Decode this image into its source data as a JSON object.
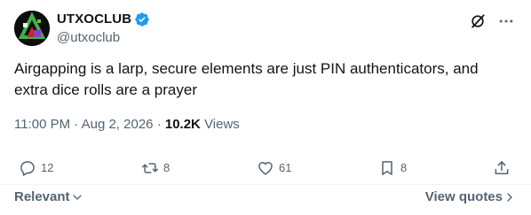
{
  "author": {
    "display_name": "UTXOCLUB",
    "handle": "@utxoclub",
    "verified": true
  },
  "tweet": {
    "text": "Airgapping is a larp, secure elements are just PIN authenticators, and extra dice rolls are a prayer",
    "time": "11:00 PM",
    "separator": "·",
    "date": "Aug 2, 2026",
    "views_count": "10.2K",
    "views_label": "Views"
  },
  "actions": {
    "replies": "12",
    "reposts": "8",
    "likes": "61",
    "bookmarks": "8"
  },
  "footer": {
    "sort_label": "Relevant",
    "view_quotes_label": "View quotes"
  },
  "colors": {
    "text": "#0f1419",
    "secondary": "#536471",
    "verified": "#1d9bf0",
    "divider": "#eff3f4"
  },
  "icons": [
    "avatar-logo",
    "verified-badge-icon",
    "grok-icon",
    "more-icon",
    "reply-icon",
    "repost-icon",
    "like-icon",
    "bookmark-icon",
    "share-icon",
    "chevron-down-icon",
    "chevron-right-icon"
  ]
}
